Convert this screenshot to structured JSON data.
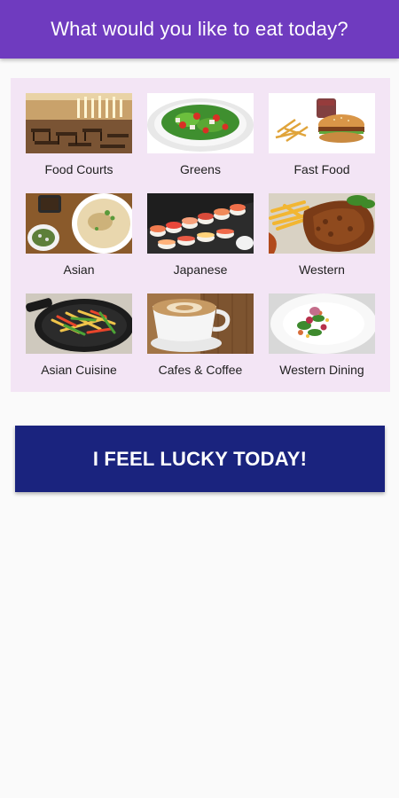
{
  "appbar": {
    "title": "What would you like to eat today?",
    "color": "#6f3bbf"
  },
  "categories": [
    {
      "label": "Food Courts",
      "image": "food-court-photo"
    },
    {
      "label": "Greens",
      "image": "salad-photo"
    },
    {
      "label": "Fast Food",
      "image": "burger-fries-photo"
    },
    {
      "label": "Asian",
      "image": "noodle-soup-photo"
    },
    {
      "label": "Japanese",
      "image": "sushi-photo"
    },
    {
      "label": "Western",
      "image": "steak-fries-photo"
    },
    {
      "label": "Asian Cuisine",
      "image": "stir-fry-wok-photo"
    },
    {
      "label": "Cafes & Coffee",
      "image": "latte-photo"
    },
    {
      "label": "Western Dining",
      "image": "plated-dish-photo"
    }
  ],
  "panel_color": "#f3e5f5",
  "lucky_button": {
    "label": "I FEEL LUCKY TODAY!",
    "color": "#1a237e"
  }
}
